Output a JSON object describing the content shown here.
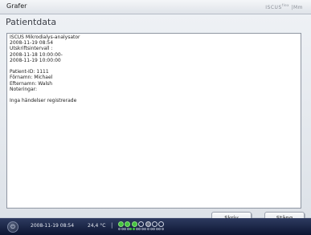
{
  "header": {
    "title": "Grafer",
    "brand": "ISCUS",
    "brand_sup": "flex",
    "brand_suffix": "|Mm"
  },
  "page": {
    "title": "Patientdata"
  },
  "report_lines": [
    "ISCUS Mikrodialys-analysator",
    "2008-11-19 08:54",
    "Utskriftsintervall :",
    "2008-11-18 10:00:00-",
    "2008-11-19 10:00:00",
    "",
    "Patient-ID: 1111",
    "Förnamn: Michael",
    "Efternamn: Walsh",
    "Noteringar:",
    "",
    "Inga händelser registrerade"
  ],
  "buttons": {
    "print": "Skriv",
    "close": "Stäng"
  },
  "statusbar": {
    "datetime": "2008-11-19 08:54",
    "temperature": "24,4 °C",
    "separator": "|"
  },
  "sample_slots": {
    "large": [
      "green",
      "green",
      "green",
      "empty",
      "gray",
      "empty",
      "empty"
    ],
    "small_count": 16,
    "small_green": [
      4,
      5
    ]
  },
  "colors": {
    "status_bg": "#13204a",
    "accent_green": "#43c340"
  }
}
